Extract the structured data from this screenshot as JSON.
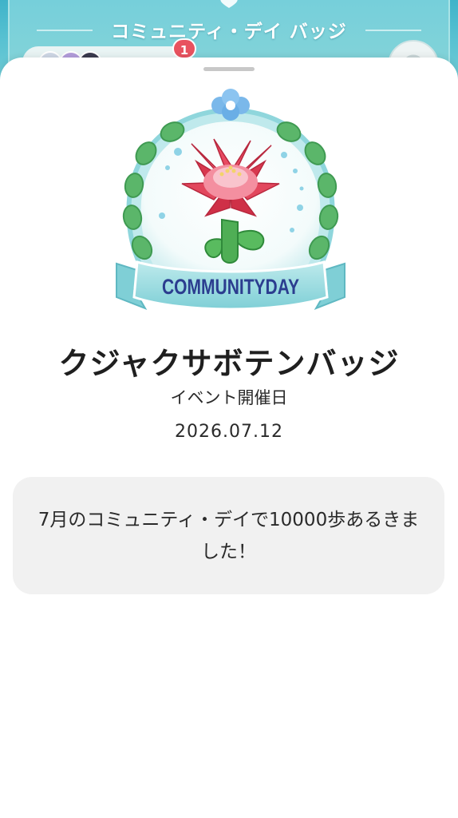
{
  "header": {
    "title": "コミュニティ・デイ バッジ",
    "notification_count": "1"
  },
  "badge": {
    "emblem_text": "COMMUNITYDAY",
    "name": "クジャクサボテンバッジ",
    "event_label": "イベント開催日",
    "event_date": "2026.07.12",
    "description": "7月のコミュニティ・デイで10000歩あるきました！"
  },
  "colors": {
    "header_teal": "#59c2d2",
    "badge_red": "#e8525f",
    "card_gray": "#f1f1f1",
    "flower_red": "#e84a62",
    "ribbon_teal": "#8fd6dc"
  },
  "icons": {
    "settings": "gear-icon",
    "friends": "avatar-icon",
    "emblem": "cactus-flower-badge-icon"
  }
}
